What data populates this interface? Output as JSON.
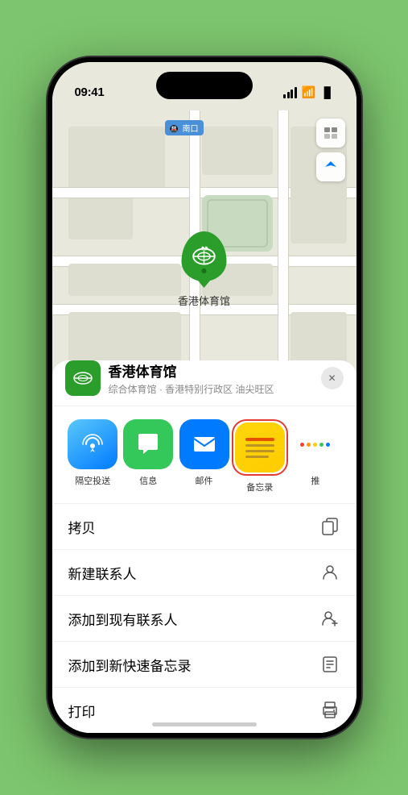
{
  "status_bar": {
    "time": "09:41",
    "location_arrow": "▶"
  },
  "map": {
    "label_badge": "南口",
    "stadium_label": "香港体育馆"
  },
  "location_header": {
    "name": "香港体育馆",
    "description": "综合体育馆 · 香港特别行政区 油尖旺区",
    "close_label": "×"
  },
  "share_items": [
    {
      "id": "airdrop",
      "label": "隔空投送",
      "type": "airdrop"
    },
    {
      "id": "messages",
      "label": "信息",
      "type": "messages"
    },
    {
      "id": "mail",
      "label": "邮件",
      "type": "mail"
    },
    {
      "id": "notes",
      "label": "备忘录",
      "type": "notes"
    },
    {
      "id": "more",
      "label": "推",
      "type": "more"
    }
  ],
  "action_items": [
    {
      "id": "copy",
      "label": "拷贝",
      "icon": "copy"
    },
    {
      "id": "new-contact",
      "label": "新建联系人",
      "icon": "person"
    },
    {
      "id": "add-existing",
      "label": "添加到现有联系人",
      "icon": "person-add"
    },
    {
      "id": "add-note",
      "label": "添加到新快速备忘录",
      "icon": "note"
    },
    {
      "id": "print",
      "label": "打印",
      "icon": "print"
    }
  ]
}
